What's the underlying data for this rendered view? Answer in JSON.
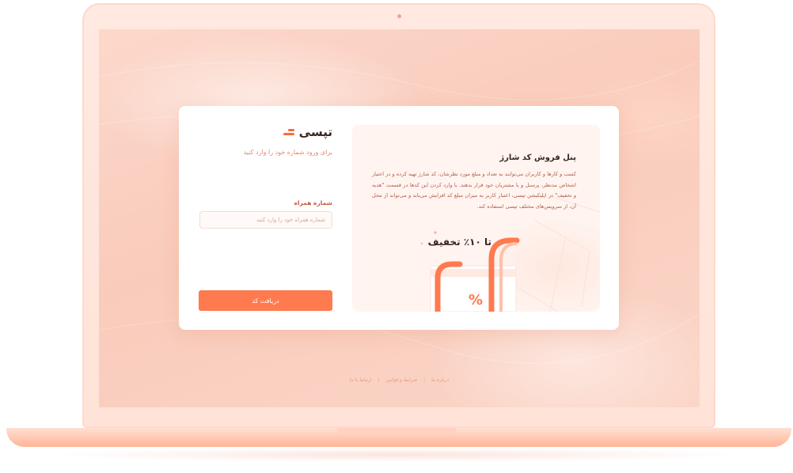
{
  "brand": {
    "name": "تپسی",
    "accent_color": "#ff7a4f"
  },
  "login": {
    "hint": "برای ورود شماره خود را وارد کنید",
    "phone_label": "شماره همراه",
    "phone_placeholder": "شماره همراه خود را وارد کنید",
    "phone_value": "",
    "submit_label": "دریافت کد"
  },
  "promo": {
    "title": "پنل فروش کد شارژ",
    "body": "کسب و کارها و کاربران می‌توانند به تعداد و مبلغ مورد نظرشان، کد شارژ تهیه کرده و در اختیار اشخاص مدنظر، پرسنل و یا مشتریان خود قرار بدهند. با وارد کردن این کدها در قسمت \"هدیه و تخفیف\" در اپلیکیشن تپسی، اعتبار کاربر به میزان مبلغ کد افزایش می‌یابد و می‌تواند از محل آن، از سرویس‌های مختلف تپسی استفاده کند.",
    "discount": "تا ۱۰٪ تخفیف",
    "percent_glyph": "%"
  },
  "footer": {
    "links": [
      "درباره ما",
      "شرایط و قوانین",
      "ارتباط با ما"
    ]
  }
}
